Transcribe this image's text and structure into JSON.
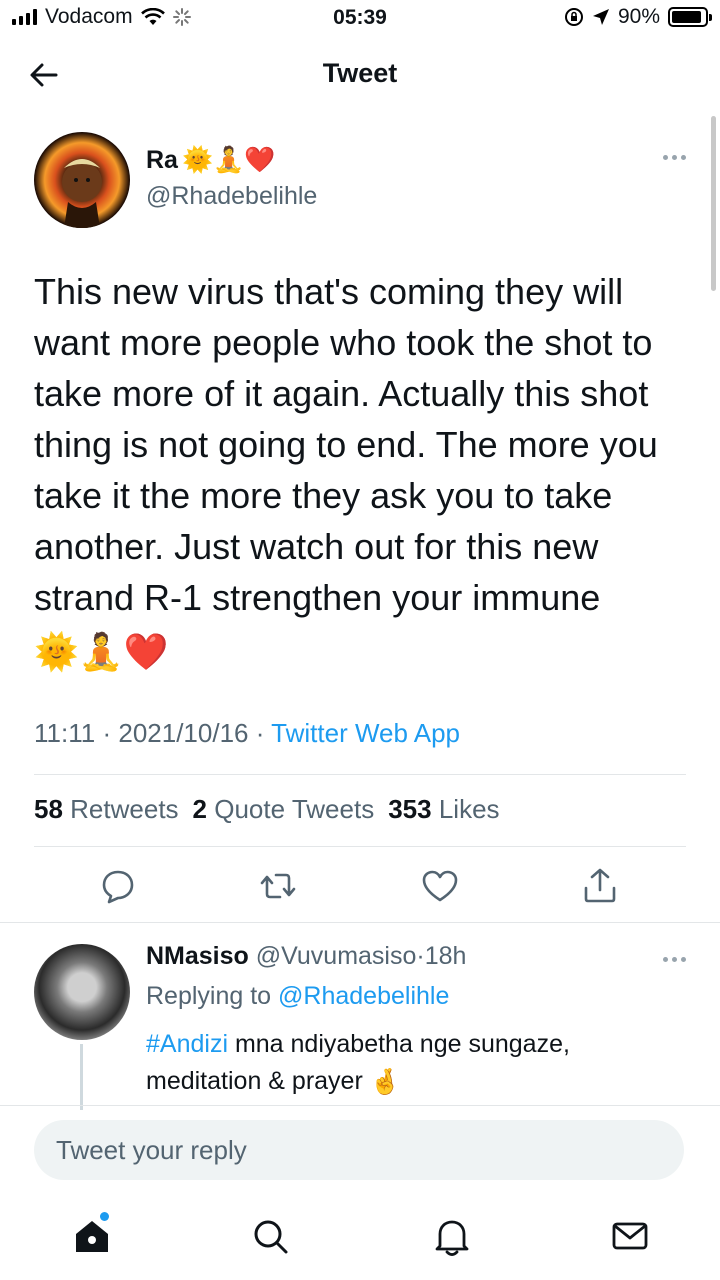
{
  "status_bar": {
    "carrier": "Vodacom",
    "time": "05:39",
    "battery": "90%",
    "battery_level": 0.9
  },
  "header": {
    "title": "Tweet"
  },
  "tweet": {
    "author_name": "Ra",
    "author_emojis": "🌞🧘❤️",
    "author_handle": "@Rhadebelihle",
    "text": "This new virus that's coming they will want more people who took the shot to take more of it again. Actually this shot thing is not going to end. The more you take it the more they ask you to take another. Just watch out for this new strand R-1 strengthen your immune",
    "text_emojis": "🌞🧘❤️",
    "time": "11:11",
    "date": "2021/10/16",
    "source": "Twitter Web App",
    "retweets": "58",
    "retweets_label": "Retweets",
    "quotes": "2",
    "quotes_label": "Quote Tweets",
    "likes": "353",
    "likes_label": "Likes"
  },
  "reply": {
    "name": "NMasiso",
    "handle": "@Vuvumasiso",
    "age": "18h",
    "replying_to_label": "Replying to",
    "replying_to": "@Rhadebelihle",
    "hashtag": "#Andizi",
    "text": "mna ndiyabetha nge sungaze, meditation & prayer",
    "emoji": "🤞"
  },
  "composer": {
    "placeholder": "Tweet your reply"
  },
  "icons": {
    "back": "arrow-left-icon",
    "more": "more-icon",
    "reply": "comment-icon",
    "retweet": "retweet-icon",
    "like": "heart-icon",
    "share": "share-icon",
    "home": "home-icon",
    "search": "search-icon",
    "notifications": "bell-icon",
    "messages": "mail-icon"
  },
  "colors": {
    "accent": "#1d9bf0",
    "text": "#0f1419",
    "muted": "#536471"
  }
}
